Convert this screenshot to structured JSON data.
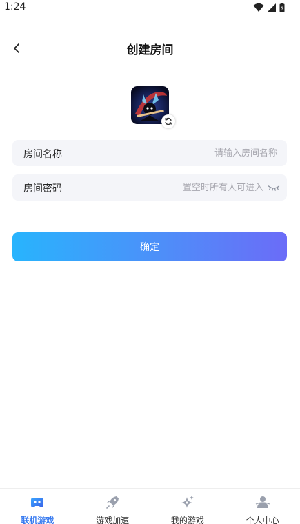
{
  "status_bar": {
    "time": "1:24"
  },
  "header": {
    "title": "创建房间"
  },
  "form": {
    "room_name": {
      "label": "房间名称",
      "placeholder": "请输入房间名称",
      "value": ""
    },
    "room_password": {
      "label": "房间密码",
      "placeholder": "置空时所有人可进入",
      "value": ""
    }
  },
  "confirm": {
    "label": "确定"
  },
  "bottom_nav": {
    "items": [
      {
        "label": "联机游戏",
        "icon": "gamepad-icon",
        "active": true
      },
      {
        "label": "游戏加速",
        "icon": "rocket-icon",
        "active": false
      },
      {
        "label": "我的游戏",
        "icon": "sparkle-icon",
        "active": false
      },
      {
        "label": "个人中心",
        "icon": "person-icon",
        "active": false
      }
    ]
  },
  "colors": {
    "accent": "#3a7cf0",
    "gradient_start": "#28b4fd",
    "gradient_end": "#6b6cf8",
    "field_bg": "#f4f5f9",
    "inactive_icon": "#9aa0ad"
  }
}
